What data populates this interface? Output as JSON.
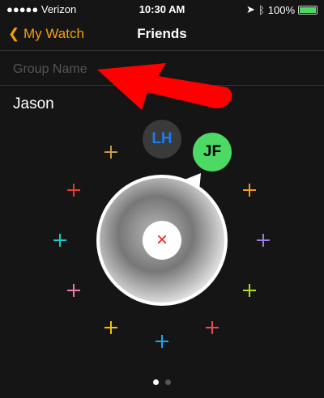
{
  "status": {
    "carrier": "●●●●● Verizon",
    "time": "10:30 AM",
    "battery": "100%",
    "battery_level": 100
  },
  "nav": {
    "back_label": "My Watch",
    "title": "Friends"
  },
  "group": {
    "placeholder": "Group Name"
  },
  "friend_name": "Jason",
  "friends": [
    {
      "initials": "LH",
      "bg": "#3a3a3a",
      "fg": "#1a7cf0"
    },
    {
      "initials": "JF",
      "bg": "#4cd964",
      "fg": "#000000"
    }
  ],
  "remove_icon": "×",
  "slot_colors": [
    "#c8994b",
    "#e83a30",
    "#1ac8c8",
    "#e87bb0",
    "#f2c200",
    "#1aa8e8",
    "#e84a5a",
    "#a8e020",
    "#9b7be8",
    "#f09a1a"
  ],
  "page_indicator": {
    "pages": 2,
    "current": 1
  },
  "arrow_color": "#ff0000"
}
